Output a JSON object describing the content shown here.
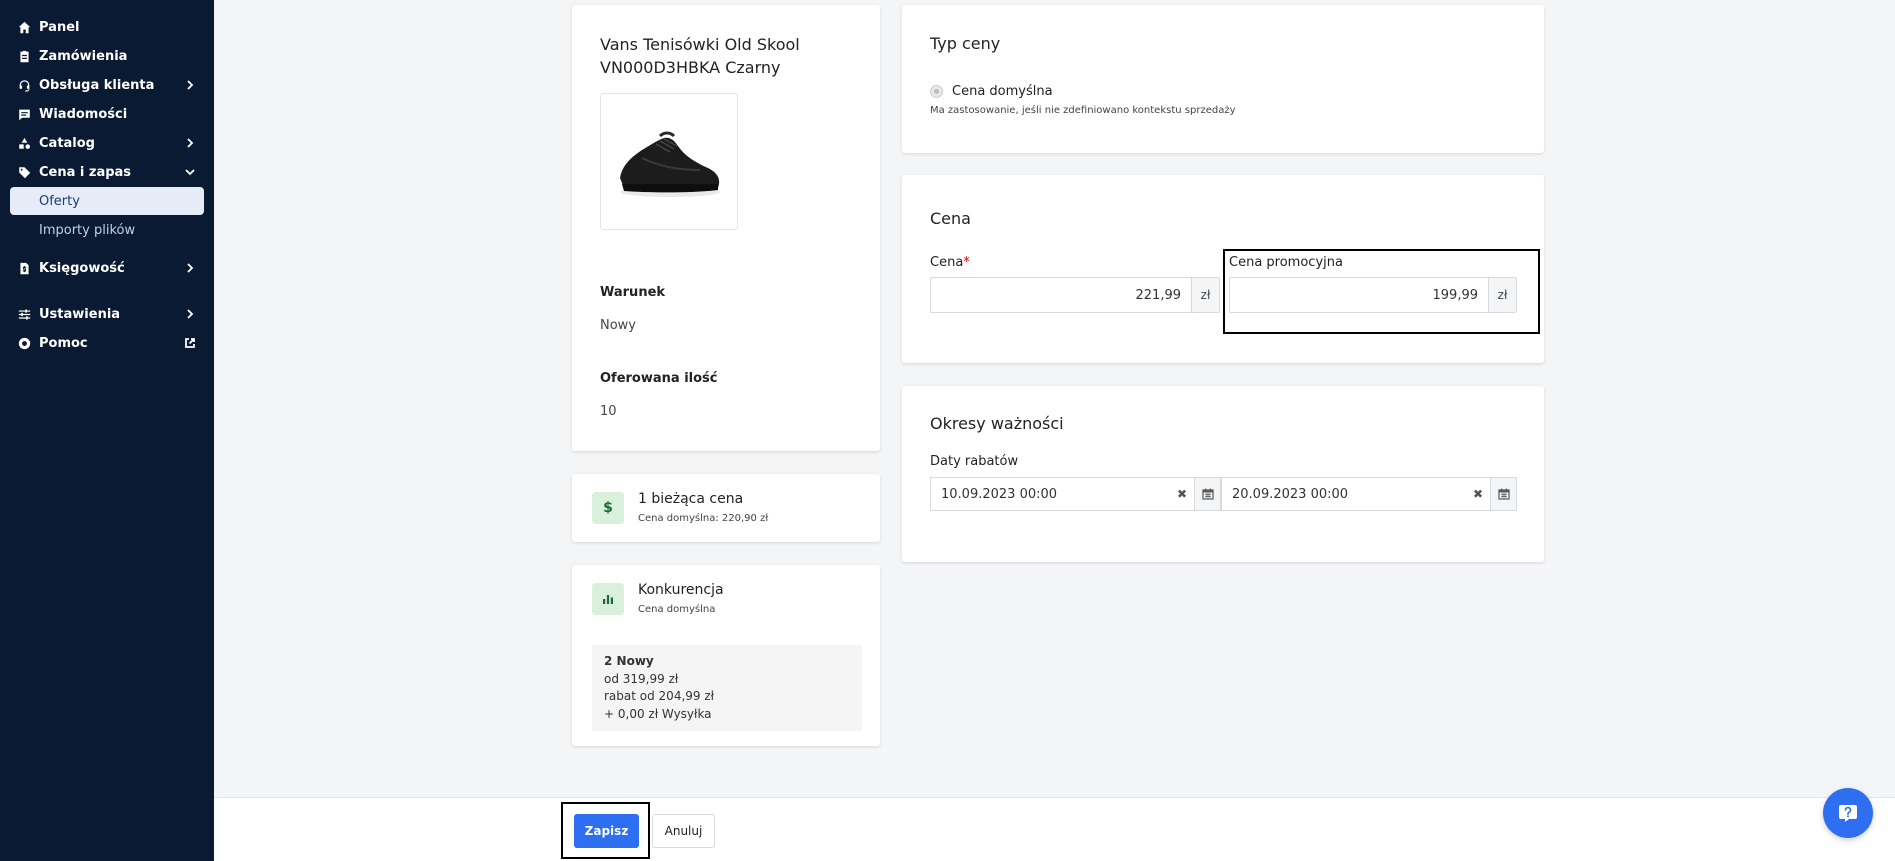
{
  "sidebar": {
    "items": [
      {
        "label": "Panel"
      },
      {
        "label": "Zamówienia"
      },
      {
        "label": "Obsługa klienta"
      },
      {
        "label": "Wiadomości"
      },
      {
        "label": "Catalog"
      },
      {
        "label": "Cena i zapas"
      },
      {
        "label": "Księgowość"
      },
      {
        "label": "Ustawienia"
      },
      {
        "label": "Pomoc"
      }
    ],
    "subitems": [
      {
        "label": "Oferty"
      },
      {
        "label": "Importy plików"
      }
    ]
  },
  "product": {
    "title": "Vans Tenisówki Old Skool VN000D3HBKA Czarny",
    "condition_label": "Warunek",
    "condition_value": "Nowy",
    "qty_label": "Oferowana ilość",
    "qty_value": "10"
  },
  "current_price": {
    "icon_glyph": "$",
    "title": "1 bieżąca cena",
    "sub": "Cena domyślna: 220,90 zł"
  },
  "competition": {
    "title": "Konkurencja",
    "sub": "Cena domyślna",
    "lines": [
      "2 Nowy",
      "od 319,99 zł",
      "rabat od 204,99 zł",
      "+ 0,00 zł Wysyłka"
    ]
  },
  "price_type": {
    "title": "Typ ceny",
    "radio_label": "Cena domyślna",
    "help": "Ma zastosowanie, jeśli nie zdefiniowano kontekstu sprzedaży"
  },
  "price": {
    "title": "Cena",
    "price_label": "Cena",
    "required_mark": "*",
    "price_value": "221,99",
    "promo_label": "Cena promocyjna",
    "promo_value": "199,99",
    "currency": "zł"
  },
  "validity": {
    "title": "Okresy ważności",
    "dates_label": "Daty rabatów",
    "date_from": "10.09.2023 00:00",
    "date_to": "20.09.2023 00:00",
    "clear_glyph": "✖"
  },
  "footer": {
    "save": "Zapisz",
    "cancel": "Anuluj"
  },
  "colors": {
    "sidebar_bg": "#0b1a33",
    "accent": "#2e6ef0",
    "active_item_bg": "#e6ecf7"
  }
}
